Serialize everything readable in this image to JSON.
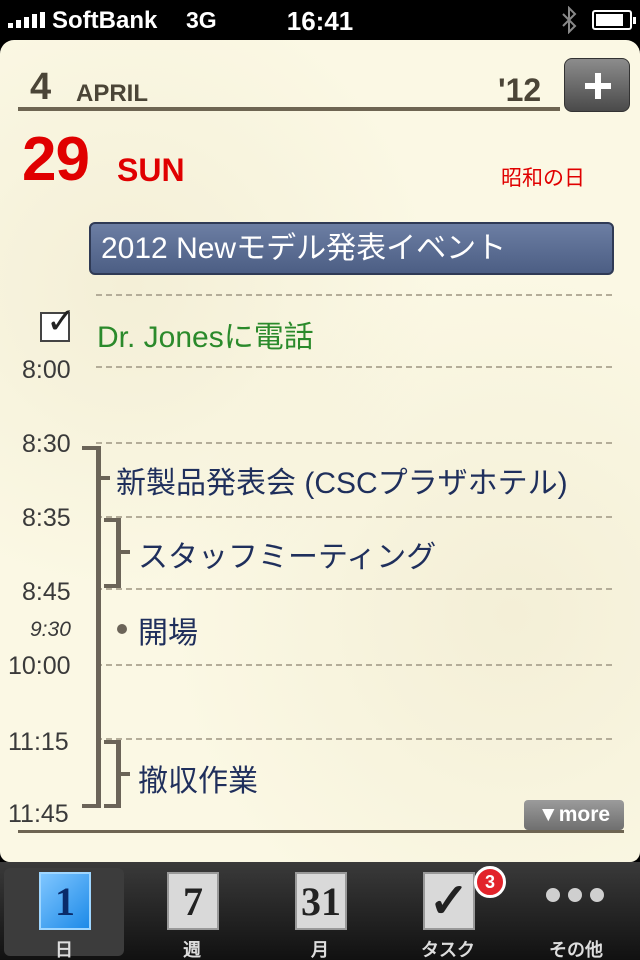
{
  "status": {
    "carrier": "SoftBank",
    "network": "3G",
    "time": "16:41",
    "battery_level": 0.85
  },
  "header": {
    "month_number": "4",
    "month_name": "APRIL",
    "year": "'12",
    "add_label": "+"
  },
  "day": {
    "number": "29",
    "weekday": "SUN",
    "holiday": "昭和の日"
  },
  "all_day_event": "2012 Newモデル発表イベント",
  "task": {
    "checked": true,
    "check_glyph": "✓",
    "text": "Dr. Jonesに電話"
  },
  "times": [
    "8:00",
    "8:30",
    "8:35",
    "8:45",
    "9:30",
    "10:00",
    "11:15",
    "11:45"
  ],
  "events": [
    "新製品発表会 (CSCプラザホテル)",
    "スタッフミーティング",
    "開場",
    "撤収作業"
  ],
  "more_label": "▼more",
  "tabs": [
    {
      "icon_text": "1",
      "label": "日",
      "active": true
    },
    {
      "icon_text": "7",
      "label": "週",
      "active": false
    },
    {
      "icon_text": "31",
      "label": "月",
      "active": false
    },
    {
      "icon_text": "✓",
      "label": "タスク",
      "active": false,
      "badge": "3"
    },
    {
      "icon_text": "",
      "label": "その他",
      "active": false
    }
  ],
  "colors": {
    "accent_red": "#e00000",
    "event_blue": "#5a6c93",
    "task_green": "#2b8a2b",
    "paper": "#fbf8e4"
  }
}
